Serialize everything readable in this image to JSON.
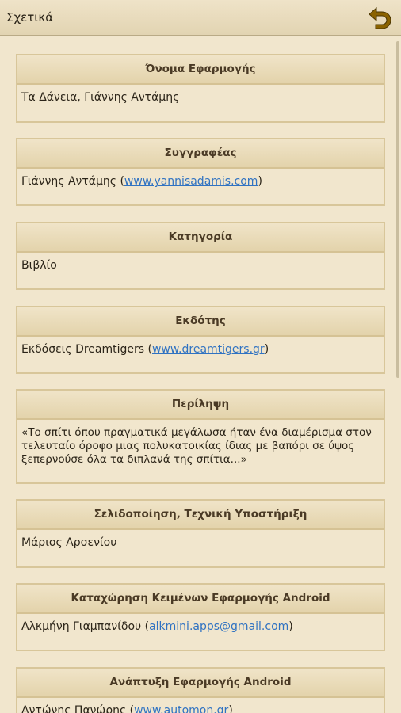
{
  "header": {
    "title": "Σχετικά",
    "back_icon": "back-arrow-icon",
    "accent": "#8a6200"
  },
  "cards": [
    {
      "title": "Όνομα Εφαρμογής",
      "text": "Τα Δάνεια, Γιάννης Αντάμης"
    },
    {
      "title": "Συγγραφέας",
      "prefix": "Γιάννης Αντάμης (",
      "link": "www.yannisadamis.com",
      "suffix": ")"
    },
    {
      "title": "Κατηγορία",
      "text": "Βιβλίο"
    },
    {
      "title": "Εκδότης",
      "prefix": "Εκδόσεις Dreamtigers (",
      "link": "www.dreamtigers.gr",
      "suffix": ")"
    },
    {
      "title": "Περίληψη",
      "text": "«Το σπίτι όπου πραγματικά μεγάλωσα ήταν ένα διαμέρισμα στον τελευταίο όροφο μιας πολυκατοικίας ίδιας με βαπόρι σε ύψος ξεπερνούσε όλα τα διπλανά της σπίτια...»"
    },
    {
      "title": "Σελιδοποίηση, Τεχνική Υποστήριξη",
      "text": "Μάριος Αρσενίου"
    },
    {
      "title": "Καταχώρηση Κειμένων Εφαρμογής Android",
      "prefix": "Αλκμήνη Γιαμπανίδου (",
      "link": "alkmini.apps@gmail.com",
      "suffix": ")"
    },
    {
      "title": "Ανάπτυξη Εφαρμογής Android",
      "prefix": "Αντώνης Πανώρης (",
      "link": "www.automon.gr",
      "suffix": ")"
    }
  ]
}
